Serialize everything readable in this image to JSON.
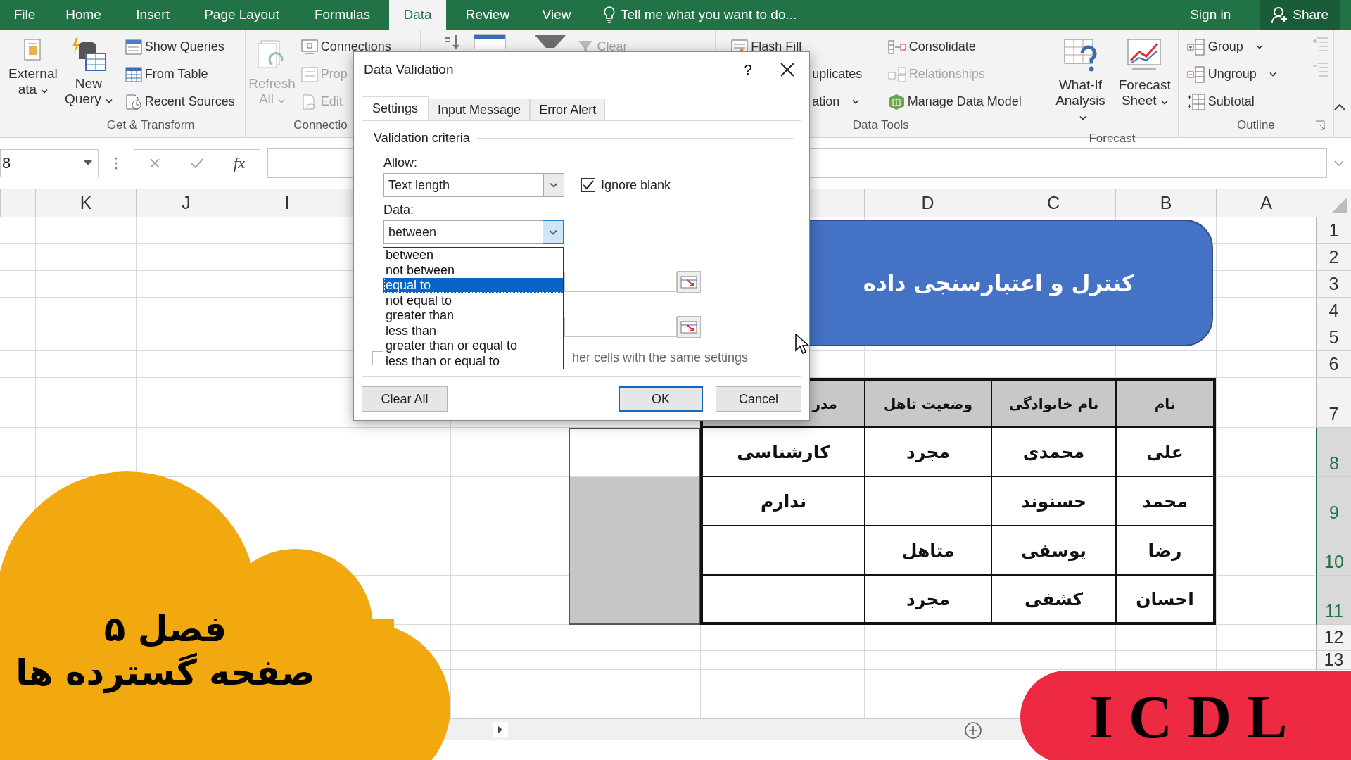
{
  "menu_tabs": [
    {
      "label": "File",
      "selected": false
    },
    {
      "label": "Home",
      "selected": false
    },
    {
      "label": "Insert",
      "selected": false
    },
    {
      "label": "Page Layout",
      "selected": false
    },
    {
      "label": "Formulas",
      "selected": false
    },
    {
      "label": "Data",
      "selected": true
    },
    {
      "label": "Review",
      "selected": false
    },
    {
      "label": "View",
      "selected": false
    }
  ],
  "tell_me": {
    "placeholder": "Tell me what you want to do..."
  },
  "account": {
    "sign_in": "Sign in",
    "share": "Share"
  },
  "ribbon": {
    "groups": [
      {
        "items": [
          {
            "label": "External",
            "sub": "ata",
            "kind": "large",
            "disabled": false
          }
        ]
      },
      {
        "label": "Get & Transform",
        "items": [
          {
            "label": "New",
            "sub": "Query",
            "kind": "large",
            "disabled": false
          },
          {
            "label": "Show Queries",
            "kind": "small",
            "disabled": false
          },
          {
            "label": "From Table",
            "kind": "small",
            "disabled": false
          },
          {
            "label": "Recent Sources",
            "kind": "small",
            "disabled": false
          }
        ]
      },
      {
        "label": "Connectio",
        "items": [
          {
            "label": "Refresh",
            "sub": "All",
            "kind": "large",
            "disabled": true
          },
          {
            "label": "Connections",
            "kind": "small",
            "disabled": false
          },
          {
            "label": "Prop",
            "kind": "small",
            "disabled": true
          },
          {
            "label": "Edit",
            "kind": "small",
            "disabled": true
          }
        ]
      },
      {
        "items": [
          {
            "label": "Clear",
            "kind": "small",
            "disabled": true
          }
        ]
      },
      {
        "label": "Data Tools",
        "items": [
          {
            "label": "Flash Fill",
            "kind": "small",
            "disabled": false
          },
          {
            "label": "uplicates",
            "kind": "small",
            "disabled": false
          },
          {
            "label": "ation",
            "kind": "small",
            "disabled": false
          },
          {
            "label": "Consolidate",
            "kind": "small",
            "disabled": false
          },
          {
            "label": "Relationships",
            "kind": "small",
            "disabled": true
          },
          {
            "label": "Manage Data Model",
            "kind": "small",
            "disabled": false
          }
        ]
      },
      {
        "label": "Forecast",
        "items": [
          {
            "label": "What-If",
            "sub": "Analysis",
            "kind": "large",
            "disabled": false
          },
          {
            "label": "Forecast",
            "sub": "Sheet",
            "kind": "large",
            "disabled": false
          }
        ]
      },
      {
        "label": "Outline",
        "items": [
          {
            "label": "Group",
            "kind": "small",
            "disabled": false
          },
          {
            "label": "Ungroup",
            "kind": "small",
            "disabled": false
          },
          {
            "label": "Subtotal",
            "kind": "small",
            "disabled": false
          }
        ]
      }
    ]
  },
  "name_box": "8",
  "formula_bar": {
    "fx": "fx"
  },
  "column_headers": [
    "K",
    "J",
    "I",
    "D",
    "C",
    "B",
    "A"
  ],
  "row_numbers": [
    "1",
    "2",
    "3",
    "4",
    "5",
    "6",
    "7",
    "8",
    "9",
    "10",
    "11",
    "12",
    "13"
  ],
  "banner": {
    "text": "کنترل و اعتبارسنجی داده"
  },
  "table": {
    "header": [
      "نام",
      "نام خانوادگی",
      "وضعیت تاهل",
      "مدر"
    ],
    "rows": [
      {
        "name": "علی",
        "family_name": "محمدی",
        "marital_status": "مجرد",
        "degree": "کارشناسی"
      },
      {
        "name": "محمد",
        "family_name": "حسنوند",
        "degree": "ندارم"
      },
      {
        "name": "رضا",
        "family_name": "یوسفی",
        "marital_status": "متاهل"
      },
      {
        "name": "احسان",
        "family_name": "کشفی",
        "marital_status": "مجرد"
      }
    ]
  },
  "dialog": {
    "title": "Data Validation",
    "help": "?",
    "tabs": [
      {
        "label": "Settings",
        "selected": true
      },
      {
        "label": "Input Message",
        "selected": false
      },
      {
        "label": "Error Alert",
        "selected": false
      }
    ],
    "section": "Validation criteria",
    "allow_label": "Allow:",
    "allow_value": "Text length",
    "ignore_blank": {
      "label": "Ignore blank",
      "checked": true
    },
    "data_label": "Data:",
    "data_value": "between",
    "data_options": [
      {
        "label": "between",
        "selected": false
      },
      {
        "label": "not between",
        "selected": false
      },
      {
        "label": "equal to",
        "selected": true
      },
      {
        "label": "not equal to",
        "selected": false
      },
      {
        "label": "greater than",
        "selected": false
      },
      {
        "label": "less than",
        "selected": false
      },
      {
        "label": "greater than or equal to",
        "selected": false
      },
      {
        "label": "less than or equal to",
        "selected": false
      }
    ],
    "apply_all": {
      "label": "her cells with the same settings",
      "checked": false
    },
    "buttons": [
      {
        "label": "Clear All",
        "kind": "normal"
      },
      {
        "label": "OK",
        "kind": "default"
      },
      {
        "label": "Cancel",
        "kind": "normal"
      }
    ]
  },
  "cloud": {
    "lines": [
      "فصل ۵",
      "صفحه گسترده ها"
    ]
  },
  "badge": {
    "text": "ICDL"
  }
}
